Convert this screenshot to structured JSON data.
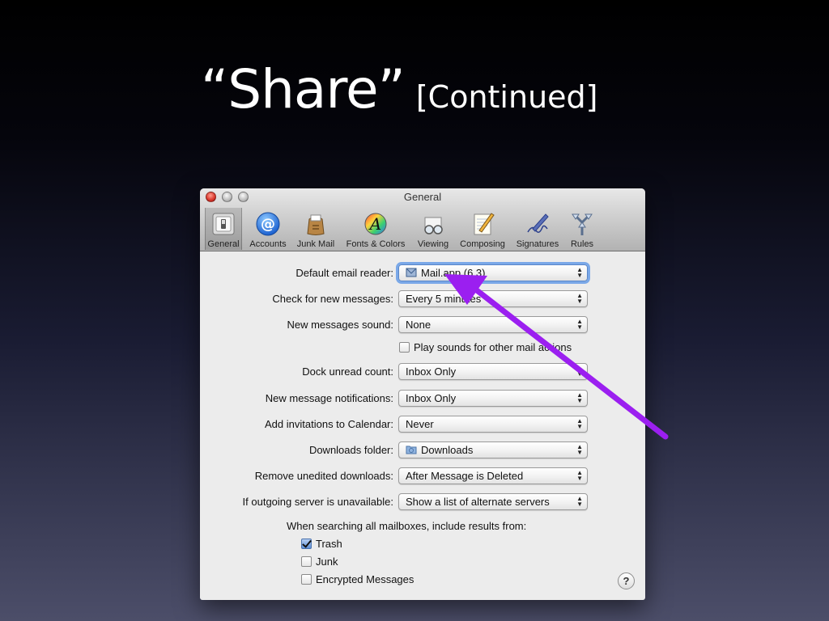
{
  "slide": {
    "title_main": "“Share”",
    "title_sub": "[Continued]"
  },
  "window": {
    "title": "General"
  },
  "toolbar": {
    "items": [
      {
        "label": "General",
        "icon": "general-switch-icon"
      },
      {
        "label": "Accounts",
        "icon": "at-sign-icon"
      },
      {
        "label": "Junk Mail",
        "icon": "junk-mail-bag-icon"
      },
      {
        "label": "Fonts & Colors",
        "icon": "fonts-colors-icon"
      },
      {
        "label": "Viewing",
        "icon": "glasses-icon"
      },
      {
        "label": "Composing",
        "icon": "composing-pencil-icon"
      },
      {
        "label": "Signatures",
        "icon": "signature-pen-icon"
      },
      {
        "label": "Rules",
        "icon": "rules-arrows-icon"
      }
    ],
    "selected": "General"
  },
  "settings": {
    "default_reader": {
      "label": "Default email reader:",
      "value": "Mail.app (6.3)"
    },
    "check_messages": {
      "label": "Check for new messages:",
      "value": "Every 5 minutes"
    },
    "new_sound": {
      "label": "New messages sound:",
      "value": "None"
    },
    "play_sounds": {
      "label": "Play sounds for other mail actions",
      "checked": false
    },
    "dock_unread": {
      "label": "Dock unread count:",
      "value": "Inbox Only"
    },
    "notifications": {
      "label": "New message notifications:",
      "value": "Inbox Only"
    },
    "invitations": {
      "label": "Add invitations to Calendar:",
      "value": "Never"
    },
    "downloads_folder": {
      "label": "Downloads folder:",
      "value": "Downloads"
    },
    "remove_downloads": {
      "label": "Remove unedited downloads:",
      "value": "After Message is Deleted"
    },
    "outgoing_server": {
      "label": "If outgoing server is unavailable:",
      "value": "Show a list of alternate servers"
    },
    "search_heading": "When searching all mailboxes, include results from:",
    "search_trash": {
      "label": "Trash",
      "checked": true
    },
    "search_junk": {
      "label": "Junk",
      "checked": false
    },
    "search_encrypted": {
      "label": "Encrypted Messages",
      "checked": false
    }
  },
  "help": {
    "label": "?"
  },
  "annotation": {
    "color": "#9b1ff0"
  },
  "colors": {
    "focus_ring": "#7aa8e8",
    "checkbox_checked": "#5e8fd6"
  }
}
